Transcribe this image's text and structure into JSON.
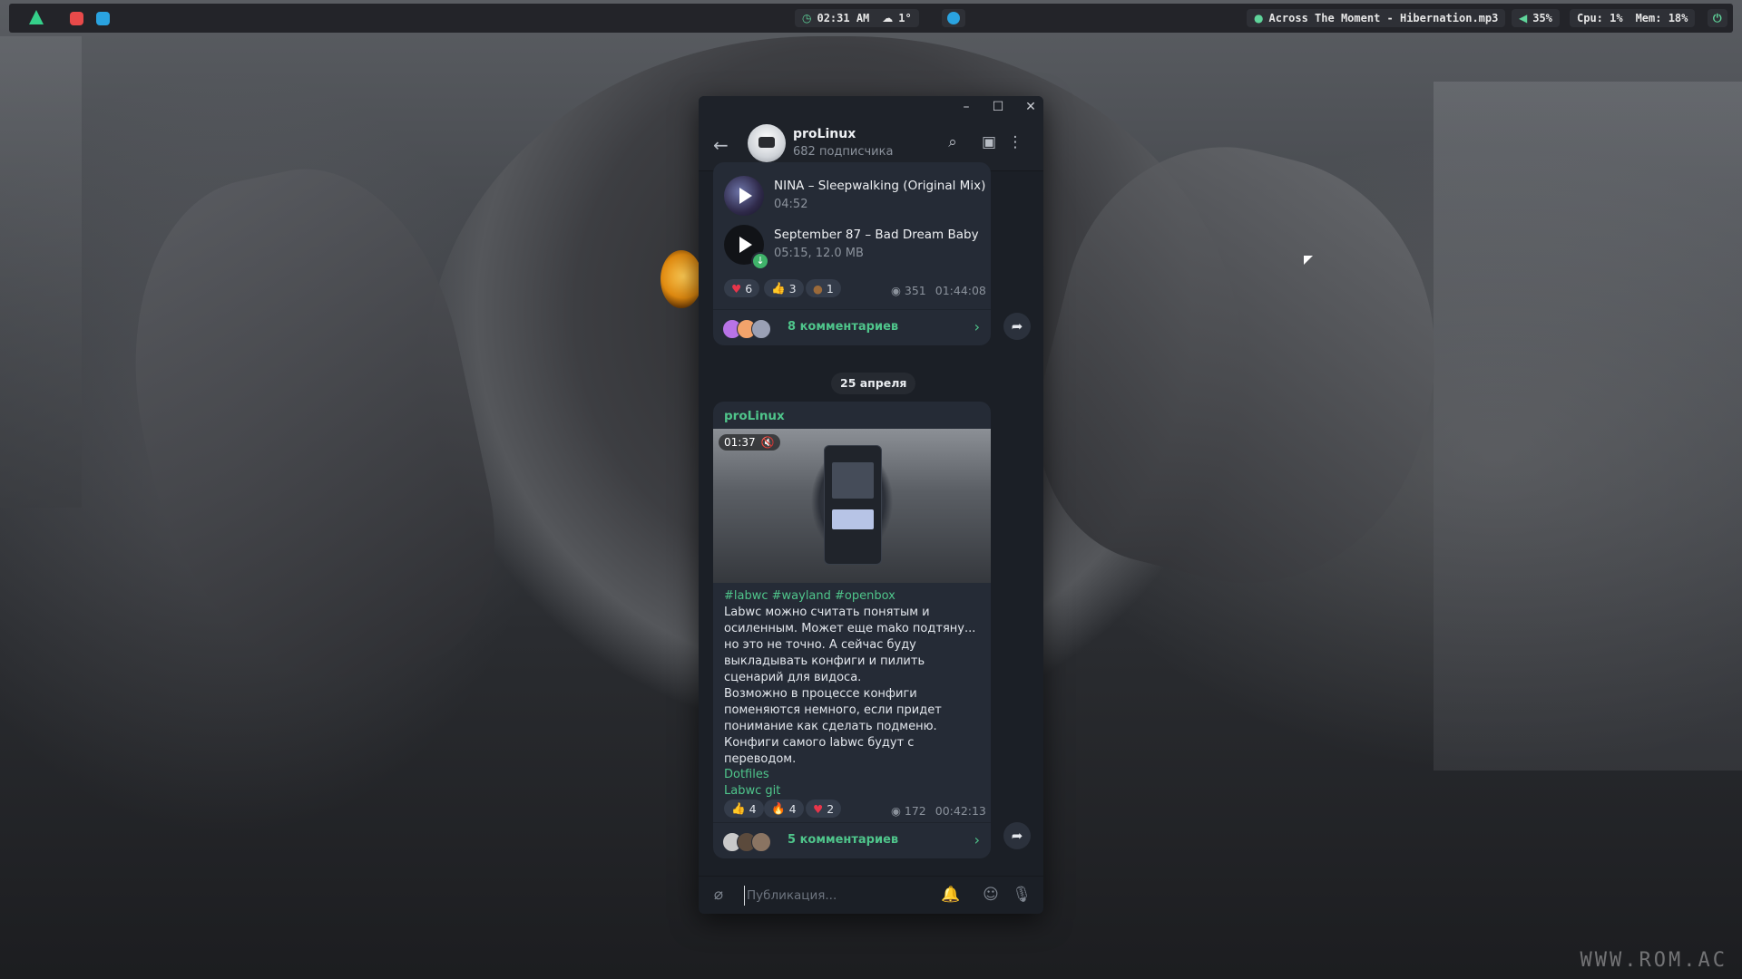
{
  "topbar": {
    "clock": "02:31 AM",
    "weather": "1°",
    "now_playing": "Across The Moment - Hibernation.mp3",
    "volume": "35%",
    "cpu": "Cpu: 1%",
    "mem": "Mem: 18%",
    "icons": [
      "arch-linux-icon",
      "app-red-icon",
      "telegram-icon",
      "clock-icon",
      "cloud-icon",
      "telegram-tray-icon",
      "music-icon",
      "volume-icon",
      "power-icon"
    ]
  },
  "telegram": {
    "window_controls": {
      "minimize": "–",
      "maximize": "☐",
      "close": "✕"
    },
    "header": {
      "title": "proLinux",
      "subtitle": "682 подписчика"
    },
    "post1": {
      "tracks": [
        {
          "title": "NINA – Sleepwalking (Original Mix)",
          "meta": "04:52"
        },
        {
          "title": "September 87 – Bad Dream Baby",
          "meta": "05:15, 12.0 MB"
        }
      ],
      "reactions": [
        {
          "emoji": "♥",
          "count": "6",
          "color": "#e8354a"
        },
        {
          "emoji": "👍",
          "count": "3",
          "color": "#f5c542"
        },
        {
          "emoji": "💩",
          "count": "1",
          "color": "#9b6a3a"
        }
      ],
      "views": "351",
      "time": "01:44:08",
      "comments": "8 комментариев"
    },
    "date_separator": "25 апреля",
    "post2": {
      "author": "proLinux",
      "video_duration": "01:37",
      "hashtags": "#labwc #wayland #openbox",
      "paragraph1": "Labwc можно считать понятым и осиленным. Может еще mako подтяну... но это не точно. А сейчас буду выкладывать конфиги и пилить сценарий для видоса.",
      "paragraph2": "Возможно в процессе конфиги поменяются немного, если придет понимание как сделать подменю. Конфиги самого labwc будут с переводом.",
      "links": [
        "Dotfiles",
        "Labwc git"
      ],
      "reactions": [
        {
          "emoji": "👍",
          "count": "4",
          "color": "#f5c542"
        },
        {
          "emoji": "🔥",
          "count": "4",
          "color": "#f28a1e"
        },
        {
          "emoji": "♥",
          "count": "2",
          "color": "#e8354a"
        }
      ],
      "views": "172",
      "time": "00:42:13",
      "comments": "5 комментариев"
    },
    "composer": {
      "placeholder": "Публикация..."
    }
  },
  "wallpaper": {
    "watermark": "WWW.ROM.AC"
  },
  "colors": {
    "accent": "#4fc58b",
    "bubble": "#252b36",
    "window": "#1b1f26"
  }
}
